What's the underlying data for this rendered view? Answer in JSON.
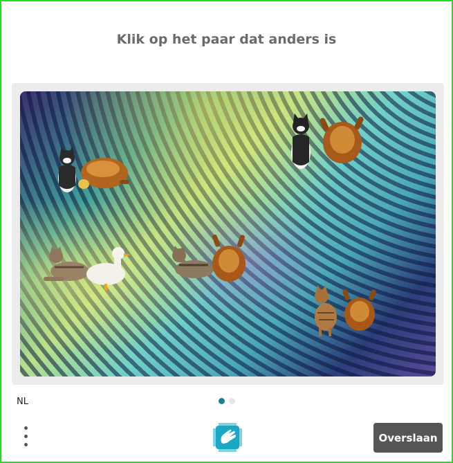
{
  "prompt": "Klik op het paar dat anders is",
  "language": "NL",
  "skip_label": "Overslaan",
  "colors": {
    "frame": "#1be01b",
    "active_dot": "#1a7f8a",
    "inactive_dot": "#e6e6e6",
    "button": "#555555"
  },
  "pagination": {
    "total": 2,
    "active": 1
  },
  "pairs": [
    {
      "name": "cat-and-roast-chicken",
      "items": [
        "cat",
        "roast-chicken"
      ]
    },
    {
      "name": "cat-and-roast-chicken",
      "items": [
        "cat",
        "roast-chicken"
      ]
    },
    {
      "name": "cat-and-duck",
      "items": [
        "cat",
        "duck"
      ]
    },
    {
      "name": "cat-and-roast-chicken",
      "items": [
        "cat",
        "roast-chicken"
      ]
    },
    {
      "name": "cat-and-roast-chicken",
      "items": [
        "cat",
        "roast-chicken"
      ]
    }
  ],
  "icons": {
    "menu": "vertical-dots-icon",
    "logo": "hcaptcha-hand-icon"
  }
}
